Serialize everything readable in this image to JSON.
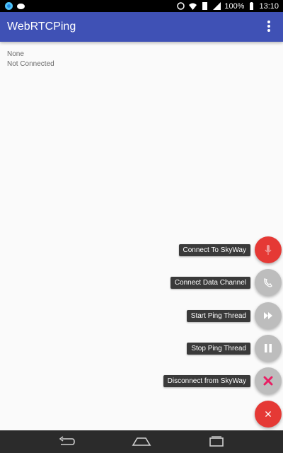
{
  "status_bar": {
    "battery": "100%",
    "time": "13:10"
  },
  "app_bar": {
    "title": "WebRTCPing",
    "menu_icon": "overflow-menu-icon"
  },
  "main": {
    "line1": "None",
    "line2": "Not Connected"
  },
  "fab_menu": {
    "items": [
      {
        "label": "Connect To SkyWay",
        "icon": "microphone-icon",
        "color": "#e53935"
      },
      {
        "label": "Connect Data Channel",
        "icon": "phone-icon",
        "color": "#bdbdbd"
      },
      {
        "label": "Start Ping Thread",
        "icon": "fast-forward-icon",
        "color": "#bdbdbd"
      },
      {
        "label": "Stop Ping Thread",
        "icon": "pause-icon",
        "color": "#bdbdbd"
      },
      {
        "label": "Disconnect from SkyWay",
        "icon": "close-icon",
        "color": "#bdbdbd"
      }
    ],
    "main_fab_icon": "close-icon",
    "main_fab_color": "#e53935"
  },
  "colors": {
    "primary": "#3f51b5",
    "accent": "#e53935",
    "disconnect_icon": "#e91e63"
  }
}
